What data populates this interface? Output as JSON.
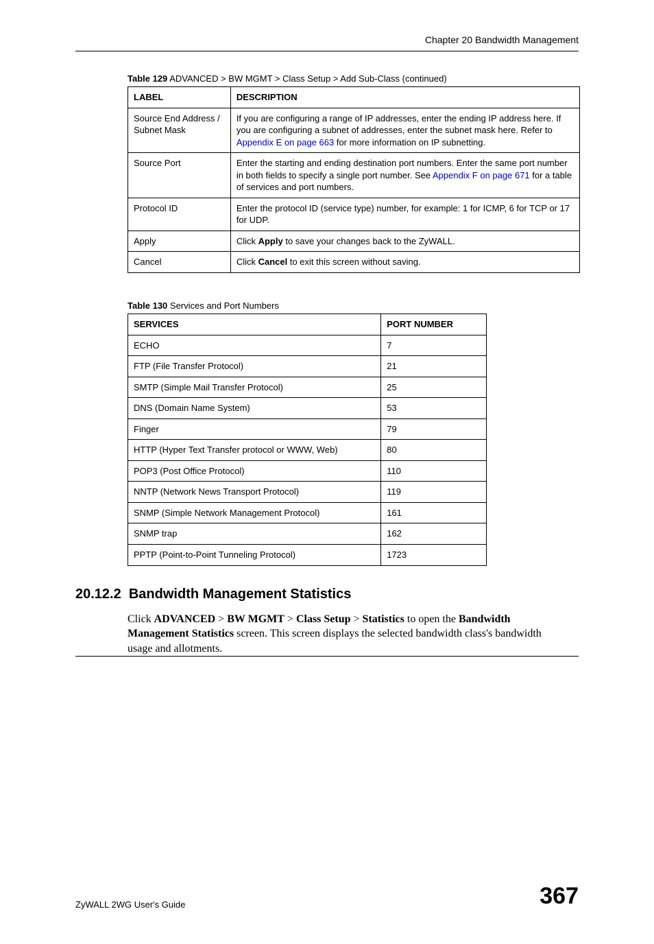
{
  "header": {
    "chapter": "Chapter 20 Bandwidth Management"
  },
  "table129": {
    "caption_bold": "Table 129",
    "caption_rest": "   ADVANCED > BW MGMT > Class Setup > Add Sub-Class (continued)",
    "headers": {
      "label": "LABEL",
      "description": "DESCRIPTION"
    },
    "rows": [
      {
        "label": "Source End Address / Subnet Mask",
        "desc_pre": "If you are configuring a range of IP addresses, enter the ending IP address here. If you are configuring a subnet of addresses, enter the subnet mask here. Refer to ",
        "desc_link": "Appendix E on page 663",
        "desc_post": " for more information on IP subnetting."
      },
      {
        "label": "Source Port",
        "desc_pre": "Enter the starting and ending destination port numbers. Enter the same port number in both fields to specify a single port number. See ",
        "desc_link": "Appendix F on page 671",
        "desc_post": " for a table of services and port numbers."
      },
      {
        "label": "Protocol ID",
        "desc_pre": "Enter the protocol ID (service type) number, for example: 1 for ICMP, 6 for TCP or 17 for UDP.",
        "desc_link": "",
        "desc_post": ""
      },
      {
        "label": "Apply",
        "desc_pre": "Click ",
        "desc_bold": "Apply",
        "desc_post": " to save your changes back to the ZyWALL."
      },
      {
        "label": "Cancel",
        "desc_pre": "Click ",
        "desc_bold": "Cancel",
        "desc_post": " to exit this screen without saving."
      }
    ]
  },
  "table130": {
    "caption_bold": "Table 130",
    "caption_rest": "   Services and Port Numbers",
    "headers": {
      "services": "SERVICES",
      "port": "PORT NUMBER"
    },
    "rows": [
      {
        "service": "ECHO",
        "port": "7"
      },
      {
        "service": "FTP (File Transfer Protocol)",
        "port": "21"
      },
      {
        "service": "SMTP (Simple Mail Transfer Protocol)",
        "port": "25"
      },
      {
        "service": "DNS (Domain Name System)",
        "port": "53"
      },
      {
        "service": "Finger",
        "port": "79"
      },
      {
        "service": "HTTP (Hyper Text Transfer protocol or WWW, Web)",
        "port": "80"
      },
      {
        "service": "POP3 (Post Office Protocol)",
        "port": "110"
      },
      {
        "service": "NNTP (Network News Transport Protocol)",
        "port": "119"
      },
      {
        "service": "SNMP (Simple Network Management Protocol)",
        "port": "161"
      },
      {
        "service": "SNMP trap",
        "port": "162"
      },
      {
        "service": "PPTP (Point-to-Point Tunneling Protocol)",
        "port": "1723"
      }
    ]
  },
  "section": {
    "number": "20.12.2",
    "title": "Bandwidth Management Statistics",
    "para_parts": {
      "p1": "Click ",
      "b1": "ADVANCED",
      "gt1": " > ",
      "b2": "BW MGMT",
      "gt2": " > ",
      "b3": "Class Setup",
      "gt3": " > ",
      "b4": "Statistics",
      "p2": " to open the ",
      "b5": "Bandwidth Management Statistics",
      "p3": " screen. This screen displays the selected bandwidth class's bandwidth usage and allotments."
    }
  },
  "footer": {
    "left": "ZyWALL 2WG User's Guide",
    "right": "367"
  }
}
